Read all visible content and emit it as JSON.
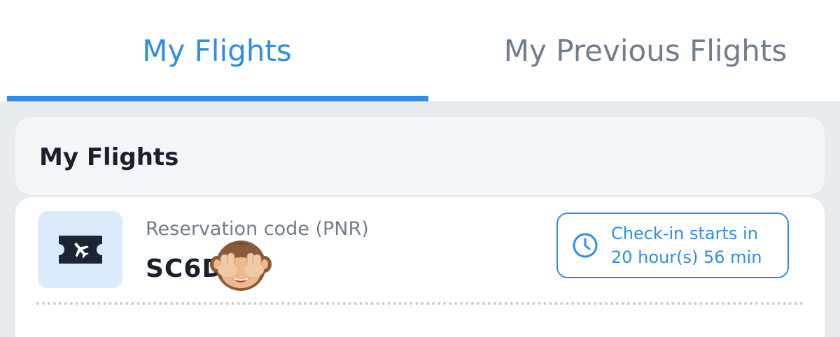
{
  "tabs": [
    {
      "label": "My Flights",
      "active": true
    },
    {
      "label": "My Previous Flights",
      "active": false
    }
  ],
  "section": {
    "title": "My Flights"
  },
  "flight": {
    "icon": "ticket-plane-icon",
    "pnr_label": "Reservation code (PNR)",
    "pnr_value": "SC6D",
    "pnr_overlay": "see-no-evil-monkey-emoji",
    "checkin": {
      "icon": "clock-icon",
      "line1": "Check-in starts in",
      "line2": "20 hour(s) 56 min"
    }
  },
  "colors": {
    "accent": "#2e8de8",
    "inactive_text": "#707d8e",
    "heading_text": "#1a202c",
    "page_bg": "#e8ebee",
    "icon_badge_bg": "#dcebfb"
  }
}
